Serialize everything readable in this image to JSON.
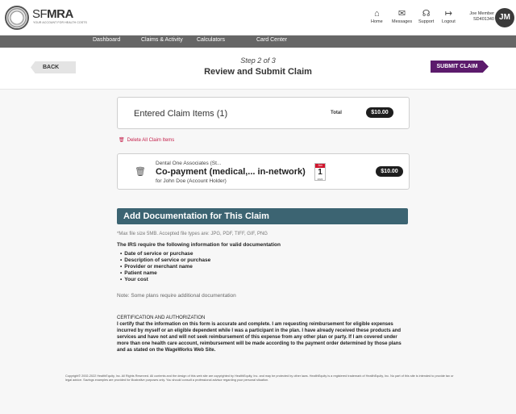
{
  "brand": {
    "name_prefix": "SF",
    "name_bold": "MRA",
    "tagline": "YOUR ACCOUNT FOR HEALTH COSTS"
  },
  "top_nav": [
    {
      "label": "Home",
      "icon": "home-icon"
    },
    {
      "label": "Messages",
      "icon": "messages-icon"
    },
    {
      "label": "Support",
      "icon": "headset-icon"
    },
    {
      "label": "Logout",
      "icon": "logout-icon"
    }
  ],
  "user": {
    "name": "Joe Member",
    "id": "SD401340",
    "initials": "JM"
  },
  "main_nav": [
    "Dashboard",
    "Claims & Activity",
    "Calculators",
    "Card Center"
  ],
  "step": {
    "label": "Step 2 of 3",
    "title": "Review and Submit Claim",
    "back_label": "BACK",
    "submit_label": "SUBMIT CLAIM"
  },
  "entered": {
    "title": "Entered Claim Items (1)",
    "total_label": "Total",
    "total_value": "$10.00"
  },
  "delete_all_label": "Delete All Claim Items",
  "claim_item": {
    "provider": "Dental One Associates (St...",
    "title": "Co-payment (medical,... in-network)",
    "patient": "for John Doe (Account Holder)",
    "cal_month": "Jan",
    "cal_day": "1",
    "cal_year": "2022",
    "amount": "$10.00"
  },
  "documentation": {
    "header": "Add Documentation for This Claim",
    "max_file": "*Max file size 5MB. Accepted file types are: JPG, PDF, TIFF, GIF, PNG",
    "irs_heading": "The IRS require the following information for valid documentation",
    "irs_items": [
      "Date of service or purchase",
      "Description of service or purchase",
      "Provider or merchant name",
      "Patient name",
      "Your cost"
    ],
    "note": "Note: Some plans require additional documentation"
  },
  "certification": {
    "heading": "CERTIFICATION AND AUTHORIZATION",
    "body": "I certify that the information on this form is accurate and complete. I am requesting reimbursement for eligible expenses incurred by myself or an eligible dependent while I was a participant in the plan. I have already received these products and services and have not and will not seek reimbursement of this expense from any other plan or party. If I am covered under more than one health care account, reimbursement will be made according to the payment order determined by those plans and as stated on the WageWorks Web Site."
  },
  "copyright": "Copyright© 2002-2022 HealthEquity, Inc. All Rights Reserved. All contents and the design of this web site are copyrighted by HealthEquity, Inc. and may be protected by other laws. HealthEquity is a registered trademark of HealthEquity, Inc. No part of this site is intended to provide tax or legal advice. Savings examples are provided for illustrative purposes only. You should consult a professional advisor regarding your personal situation.",
  "colors": {
    "nav_bg": "#666666",
    "submit_bg": "#5c1b6c",
    "doc_header_bg": "#3c6472",
    "delete_red": "#c41f4a"
  }
}
